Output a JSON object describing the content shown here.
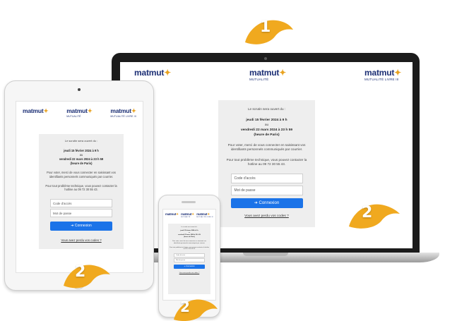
{
  "brand": {
    "wordmark": "matmut",
    "star": "✦",
    "colors": {
      "navy": "#1c2f75",
      "gold": "#e9a321",
      "button": "#1b73e8",
      "panel": "#eeeeee"
    }
  },
  "logos": [
    {
      "word": "matmut",
      "sub": ""
    },
    {
      "word": "matmut",
      "sub": "MUTUALITÉ"
    },
    {
      "word": "matmut",
      "sub": "MUTUALITÉ LIVRE III"
    }
  ],
  "login": {
    "intro": "Le scrutin sera ouvert du :",
    "start": "jeudi 15 février 2024 à 9 h",
    "au": "au",
    "end": "vendredi 22 mars 2024 à 23 h 59",
    "timezone": "(heure de Paris)",
    "instructions": "Pour voter, merci de vous connecter en saisissant vos identifiants personnels communiqués par courrier.",
    "support": "Pour tout problème technique, vous pouvez contacter la hotline au 09 72 30 55 43.",
    "code_placeholder": "Code d'accès",
    "password_placeholder": "Mot de passe",
    "submit_icon": "login-arrow-icon",
    "submit_label": "Connexion",
    "forgot_link": "Vous avez perdu vos codes ?"
  },
  "badges": {
    "laptop": "1",
    "laptop_screen": "2",
    "tablet": "2",
    "phone": "2"
  }
}
